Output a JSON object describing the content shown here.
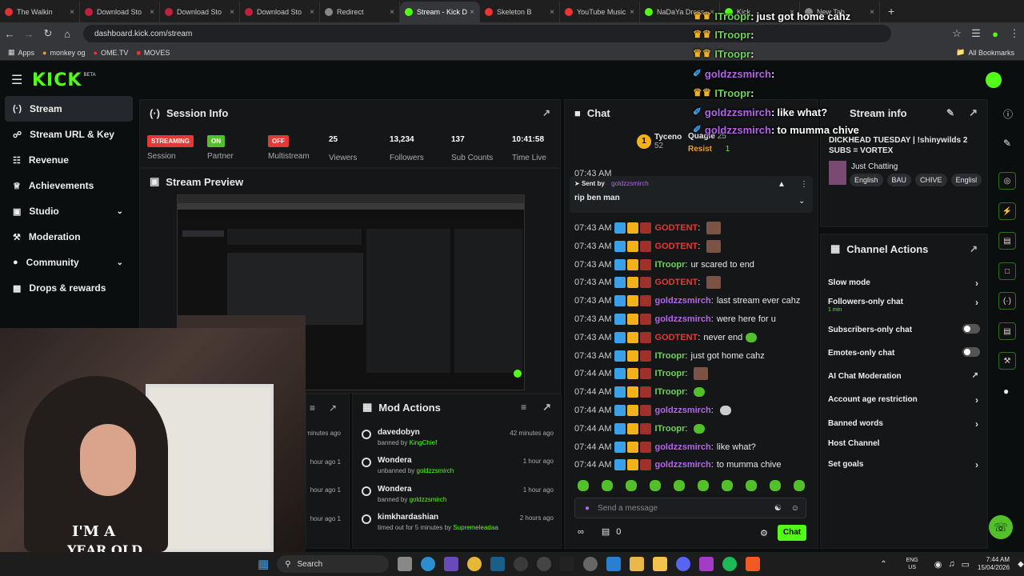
{
  "browser": {
    "tabs": [
      {
        "label": "The Walkin",
        "color": "#d33"
      },
      {
        "label": "Download Sto",
        "color": "#c0213d"
      },
      {
        "label": "Download Sto",
        "color": "#c0213d"
      },
      {
        "label": "Download Sto",
        "color": "#c0213d"
      },
      {
        "label": "Redirect",
        "color": "#888"
      },
      {
        "label": "Stream - Kick D",
        "color": "#53fc18"
      },
      {
        "label": "Skeleton B",
        "color": "#e33"
      },
      {
        "label": "YouTube Music",
        "color": "#e33"
      },
      {
        "label": "NaDaYa Dress",
        "color": "#53fc18"
      },
      {
        "label": "Kick",
        "color": "#53fc18"
      },
      {
        "label": "New Tab",
        "color": "#888"
      }
    ],
    "url": "dashboard.kick.com/stream",
    "bookmarks": [
      "Apps",
      "monkey og",
      "OME.TV",
      "MOVES"
    ],
    "all_bookmarks": "All Bookmarks"
  },
  "brand": {
    "logo": "KICK",
    "beta": "BETA",
    "accent": "#53fc18"
  },
  "sidebar": {
    "items": [
      {
        "label": "Stream",
        "icon": "broadcast-icon"
      },
      {
        "label": "Stream URL & Key",
        "icon": "link-icon"
      },
      {
        "label": "Revenue",
        "icon": "chart-icon"
      },
      {
        "label": "Achievements",
        "icon": "trophy-icon"
      },
      {
        "label": "Studio",
        "icon": "monitor-icon"
      },
      {
        "label": "Moderation",
        "icon": "wrench-icon"
      },
      {
        "label": "Community",
        "icon": "users-icon"
      },
      {
        "label": "Drops & rewards",
        "icon": "gift-icon"
      }
    ]
  },
  "session": {
    "title": "Session Info",
    "streaming": "STREAMING",
    "session_label": "Session",
    "partner_badge": "ON",
    "partner_label": "Partner",
    "multistream_badge": "OFF",
    "multistream_label": "Multistream",
    "viewers": "25",
    "viewers_label": "Viewers",
    "followers": "13,234",
    "followers_label": "Followers",
    "subs": "137",
    "subs_label": "Sub Counts",
    "time": "10:41:58",
    "time_label": "Time Live"
  },
  "preview": {
    "title": "Stream Preview"
  },
  "webcam": {
    "shirt_text_1": "I'M A",
    "shirt_text_2": "YEAR OLD"
  },
  "mod_actions": {
    "title": "Mod Actions",
    "partial_times": [
      "minutes ago",
      "1 hour ago",
      "1 hour ago",
      "1 hour ago"
    ],
    "items": [
      {
        "name": "davedobyn",
        "action": "banned by",
        "by": "KingChief",
        "time": "42 minutes ago"
      },
      {
        "name": "Wondera",
        "action": "unbanned by",
        "by": "goldzzsmirch",
        "time": "1 hour ago"
      },
      {
        "name": "Wondera",
        "action": "banned by",
        "by": "goldzzsmirch",
        "time": "1 hour ago"
      },
      {
        "name": "kimkhardashian",
        "action": "timed out for 5 minutes by",
        "by": "Supremeleadaa",
        "time": "2 hours ago"
      }
    ]
  },
  "chat": {
    "title": "Chat",
    "top_users": [
      {
        "name": "Tyceno",
        "count": "52"
      },
      {
        "name": "Quagie",
        "count": "25"
      },
      {
        "name": "Resist",
        "count": "1"
      }
    ],
    "pinned": {
      "sent_by_label": "Sent by",
      "sender": "goldzzsmirch",
      "text": "rip ben man"
    },
    "messages": [
      {
        "time": "07:43 AM",
        "user": "GODTENT",
        "color": "#e53935",
        "text": "",
        "emote": "p"
      },
      {
        "time": "07:43 AM",
        "user": "GODTENT",
        "color": "#e53935",
        "text": "",
        "emote": "p"
      },
      {
        "time": "07:43 AM",
        "user": "ITroopr",
        "color": "#6fd35a",
        "text": "ur scared to end",
        "emote": ""
      },
      {
        "time": "07:43 AM",
        "user": "GODTENT",
        "color": "#e53935",
        "text": "",
        "emote": "p"
      },
      {
        "time": "07:43 AM",
        "user": "goldzzsmirch",
        "color": "#b566e8",
        "text": "last stream ever cahz",
        "emote": ""
      },
      {
        "time": "07:43 AM",
        "user": "goldzzsmirch",
        "color": "#b566e8",
        "text": "were here for u",
        "emote": ""
      },
      {
        "time": "07:43 AM",
        "user": "GODTENT",
        "color": "#e53935",
        "text": "never end",
        "emote": "g"
      },
      {
        "time": "07:43 AM",
        "user": "ITroopr",
        "color": "#6fd35a",
        "text": "just got home cahz",
        "emote": ""
      },
      {
        "time": "07:44 AM",
        "user": "ITroopr",
        "color": "#6fd35a",
        "text": "",
        "emote": "p"
      },
      {
        "time": "07:44 AM",
        "user": "ITroopr",
        "color": "#6fd35a",
        "text": "",
        "emote": "g"
      },
      {
        "time": "07:44 AM",
        "user": "goldzzsmirch",
        "color": "#b566e8",
        "text": "",
        "emote": "s"
      },
      {
        "time": "07:44 AM",
        "user": "ITroopr",
        "color": "#6fd35a",
        "text": "",
        "emote": "g"
      },
      {
        "time": "07:44 AM",
        "user": "goldzzsmirch",
        "color": "#b566e8",
        "text": "like what?",
        "emote": ""
      },
      {
        "time": "07:44 AM",
        "user": "goldzzsmirch",
        "color": "#b566e8",
        "text": "to mumma chive",
        "emote": ""
      }
    ],
    "partial_time": "07:43 AM",
    "input_placeholder": "Send a message",
    "points": "0",
    "send_label": "Chat"
  },
  "overlay": {
    "messages": [
      {
        "user": "ITroopr",
        "color": "#6fd35a",
        "text": "just got home cahz"
      },
      {
        "user": "ITroopr",
        "color": "#6fd35a",
        "text": ""
      },
      {
        "user": "ITroopr",
        "color": "#6fd35a",
        "text": ""
      },
      {
        "user": "goldzzsmirch",
        "color": "#b566e8",
        "text": ""
      },
      {
        "user": "ITroopr",
        "color": "#6fd35a",
        "text": ""
      },
      {
        "user": "goldzzsmirch",
        "color": "#b566e8",
        "text": "like what?"
      },
      {
        "user": "goldzzsmirch",
        "color": "#b566e8",
        "text": "to mumma chive"
      }
    ]
  },
  "stream_info": {
    "title": "Stream info",
    "stream_title": "DICKHEAD TUESDAY | !shinywilds 2 SUBS = VORTEX",
    "category": "Just Chatting",
    "tags": [
      "English",
      "BAU",
      "CHIVE",
      "Englisl"
    ]
  },
  "channel_actions": {
    "title": "Channel Actions",
    "items": [
      {
        "label": "Slow mode",
        "control": "chevron",
        "sub": ""
      },
      {
        "label": "Followers-only chat",
        "control": "chevron",
        "sub": "1 min"
      },
      {
        "label": "Subscribers-only chat",
        "control": "toggle",
        "sub": ""
      },
      {
        "label": "Emotes-only chat",
        "control": "toggle",
        "sub": ""
      },
      {
        "label": "AI Chat Moderation",
        "control": "external",
        "sub": ""
      },
      {
        "label": "Account age restriction",
        "control": "chevron",
        "sub": ""
      },
      {
        "label": "Banned words",
        "control": "chevron",
        "sub": ""
      },
      {
        "label": "Host Channel",
        "control": "none",
        "sub": ""
      },
      {
        "label": "Set goals",
        "control": "chevron",
        "sub": ""
      }
    ]
  },
  "taskbar": {
    "search": "Search",
    "lang": "ENG",
    "region": "US",
    "time": "7:44 AM",
    "date": "15/04/2026"
  }
}
